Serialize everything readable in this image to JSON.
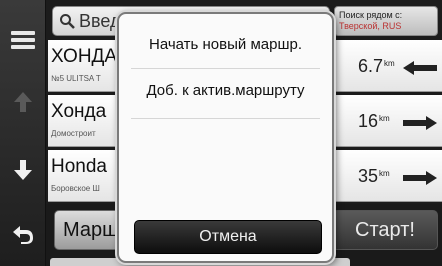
{
  "search": {
    "placeholder": "Введ"
  },
  "nearby": {
    "label": "Поиск рядом с:",
    "value": "Тверской, RUS"
  },
  "results": [
    {
      "name": "ХОНДА",
      "address": "№5 ULITSA T",
      "distance": "6.7",
      "unit": "km",
      "direction": "left"
    },
    {
      "name": "Хонда",
      "address": "Домостроит",
      "distance": "16",
      "unit": "km",
      "direction": "right"
    },
    {
      "name": "Honda",
      "address": "Боровское Ш",
      "distance": "35",
      "unit": "km",
      "direction": "right"
    }
  ],
  "buttons": {
    "route": "Марш",
    "start": "Старт!"
  },
  "popup": {
    "option_new_route": "Начать новый маршр.",
    "option_add_route": "Доб. к актив.маршруту",
    "cancel": "Отмена"
  },
  "colors": {
    "popup_bg": "#fafafa",
    "cancel_bg": "#111111",
    "list_bg": "#ffffff"
  },
  "icons": [
    "menu-icon",
    "arrow-up-icon",
    "arrow-down-icon",
    "back-icon",
    "search-icon",
    "arrow-left-icon",
    "arrow-right-icon"
  ]
}
